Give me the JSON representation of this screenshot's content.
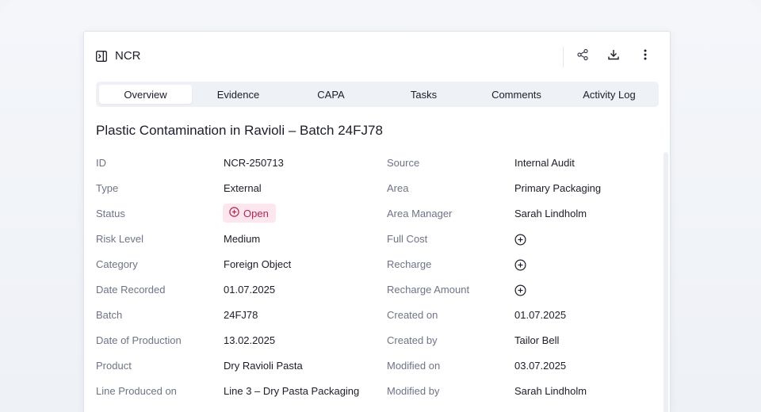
{
  "header": {
    "title": "NCR"
  },
  "header_icons": [
    "panel-toggle-icon",
    "share-icon",
    "download-icon",
    "more-vertical-icon"
  ],
  "tabs": [
    {
      "label": "Overview",
      "active": true
    },
    {
      "label": "Evidence",
      "active": false
    },
    {
      "label": "CAPA",
      "active": false
    },
    {
      "label": "Tasks",
      "active": false
    },
    {
      "label": "Comments",
      "active": false
    },
    {
      "label": "Activity Log",
      "active": false
    }
  ],
  "record": {
    "title": "Plastic Contamination in Ravioli – Batch 24FJ78"
  },
  "left_fields": [
    {
      "label": "ID",
      "value": "NCR-250713"
    },
    {
      "label": "Type",
      "value": "External"
    },
    {
      "label": "Status",
      "value": "Open"
    },
    {
      "label": "Risk Level",
      "value": "Medium"
    },
    {
      "label": "Category",
      "value": "Foreign Object"
    },
    {
      "label": "Date Recorded",
      "value": "01.07.2025"
    },
    {
      "label": "Batch",
      "value": "24FJ78"
    },
    {
      "label": "Date of Production",
      "value": "13.02.2025"
    },
    {
      "label": "Product",
      "value": "Dry Ravioli Pasta"
    },
    {
      "label": "Line Produced on",
      "value": "Line 3 – Dry Pasta Packaging"
    }
  ],
  "right_fields": [
    {
      "label": "Source",
      "value": "Internal Audit"
    },
    {
      "label": "Area",
      "value": "Primary Packaging"
    },
    {
      "label": "Area Manager",
      "value": "Sarah Lindholm"
    },
    {
      "label": "Full Cost",
      "value": ""
    },
    {
      "label": "Recharge",
      "value": ""
    },
    {
      "label": "Recharge Amount",
      "value": ""
    },
    {
      "label": "Created on",
      "value": "01.07.2025"
    },
    {
      "label": "Created by",
      "value": "Tailor Bell"
    },
    {
      "label": "Modified on",
      "value": "03.07.2025"
    },
    {
      "label": "Modified by",
      "value": "Sarah Lindholm"
    }
  ],
  "colors": {
    "status_open_bg": "#fde6ee",
    "status_open_text": "#b3264f",
    "label_text": "#6e7487",
    "tab_bg": "#eef1f6"
  }
}
